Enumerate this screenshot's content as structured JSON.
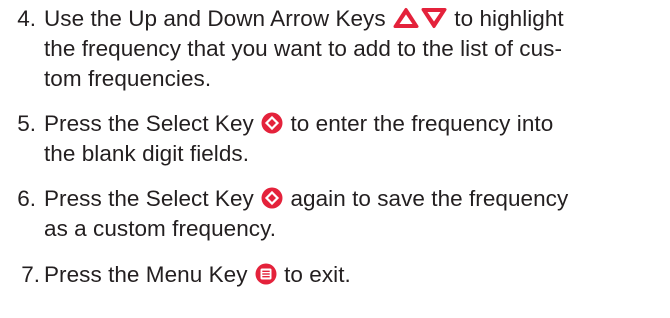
{
  "colors": {
    "text": "#231f20",
    "key_red": "#e4223b",
    "key_white": "#ffffff"
  },
  "steps": [
    {
      "number": "4.",
      "lines": [
        {
          "before": "Use the Up and Down Arrow Keys",
          "after": "to highlight"
        },
        "the frequency that you want to add to the list of cus-",
        "tom frequencies."
      ],
      "icons": [
        "up-arrow-key-icon",
        "down-arrow-key-icon"
      ]
    },
    {
      "number": "5.",
      "lines": [
        {
          "before": "Press the Select Key",
          "after": "to enter the frequency into"
        },
        "the blank digit fields."
      ],
      "icons": [
        "select-key-icon"
      ]
    },
    {
      "number": "6.",
      "lines": [
        {
          "before": "Press the Select Key",
          "after": "again to save the frequency"
        },
        "as a custom frequency."
      ],
      "icons": [
        "select-key-icon"
      ]
    },
    {
      "number": "7.",
      "lines": [
        {
          "before": "Press the Menu Key",
          "after": "to exit."
        }
      ],
      "icons": [
        "menu-key-icon"
      ]
    }
  ]
}
